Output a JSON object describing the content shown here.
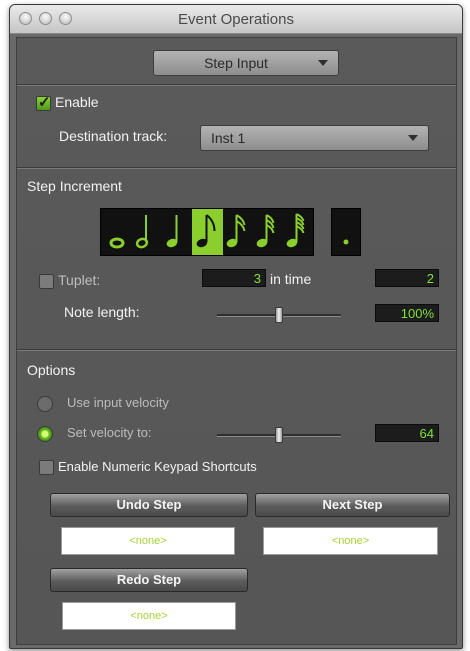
{
  "window": {
    "title": "Event Operations"
  },
  "mode_popup": {
    "value": "Step Input"
  },
  "enable": {
    "label": "Enable",
    "checked": true
  },
  "destination": {
    "label": "Destination track:",
    "value": "Inst 1"
  },
  "step_increment": {
    "heading": "Step Increment",
    "notes": [
      {
        "name": "whole-note",
        "selected": false
      },
      {
        "name": "half-note",
        "selected": false
      },
      {
        "name": "quarter-note",
        "selected": false
      },
      {
        "name": "eighth-note",
        "selected": true
      },
      {
        "name": "sixteenth-note",
        "selected": false
      },
      {
        "name": "thirty-second-note",
        "selected": false
      },
      {
        "name": "sixty-fourth-note",
        "selected": false
      }
    ],
    "dotted": {
      "selected": false
    },
    "tuplet": {
      "label": "Tuplet:",
      "checked": false,
      "value": "3",
      "in_time_label": "in time",
      "in_time_value": "2"
    },
    "note_length": {
      "label": "Note length:",
      "value": "100%",
      "level": 0.5
    }
  },
  "options": {
    "heading": "Options",
    "use_input_velocity": {
      "label": "Use input velocity",
      "selected": false
    },
    "set_velocity": {
      "label": "Set velocity to:",
      "selected": true,
      "value": "64",
      "level": 0.5
    },
    "numeric_keypad": {
      "label": "Enable Numeric Keypad Shortcuts",
      "checked": false
    }
  },
  "buttons": {
    "undo_step": {
      "label": "Undo Step",
      "shortcut": "<none>"
    },
    "next_step": {
      "label": "Next Step",
      "shortcut": "<none>"
    },
    "redo_step": {
      "label": "Redo Step",
      "shortcut": "<none>"
    }
  },
  "colors": {
    "accent": "#8bcf2e",
    "field_text": "#7fe23a",
    "shortcut_text": "#a7d13a"
  }
}
